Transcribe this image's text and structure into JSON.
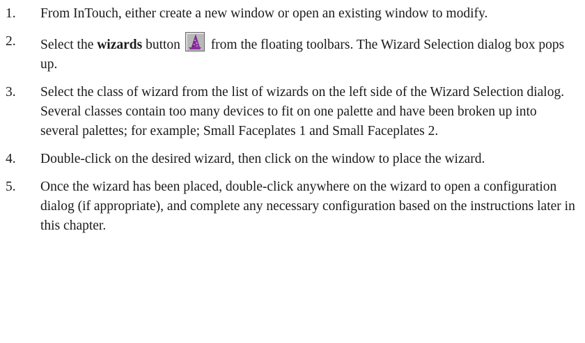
{
  "steps": [
    {
      "number": "1.",
      "text": "From InTouch, either create a new window or open an existing window to modify."
    },
    {
      "number": "2.",
      "text_before": "Select the ",
      "bold": "wizards",
      "text_middle": " button ",
      "icon": "wizard-hat-icon",
      "text_after": " from the floating toolbars. The Wizard Selection dialog box pops up."
    },
    {
      "number": "3.",
      "text": "Select the class of wizard from the list of wizards on the left side of the Wizard Selection dialog. Several classes contain too many devices to fit on one palette and have been broken up into several palettes; for example; Small Faceplates 1 and Small Faceplates 2."
    },
    {
      "number": "4.",
      "text": "Double-click on the desired wizard, then click on the window to place the wizard."
    },
    {
      "number": "5.",
      "text": "Once the wizard has been placed, double-click anywhere on the wizard to open a configuration dialog (if appropriate), and complete any necessary configuration based on the instructions later in this chapter."
    }
  ],
  "colors": {
    "text": "#1a1a1a",
    "icon_bg": "#a0a0a0",
    "icon_hat": "#8a2f9e",
    "icon_accent": "#e0c8f0"
  }
}
